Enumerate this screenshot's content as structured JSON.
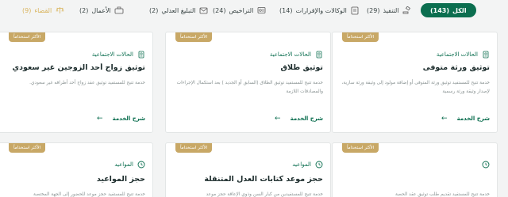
{
  "tabs": [
    {
      "label": "الكل",
      "count": "(143)",
      "icon": "none",
      "active": true
    },
    {
      "label": "التنفيذ",
      "count": "(29)",
      "icon": "gavel-icon"
    },
    {
      "label": "الوكالات والإقرارات",
      "count": "(14)",
      "icon": "document-icon"
    },
    {
      "label": "التراخيص",
      "count": "(24)",
      "icon": "license-icon"
    },
    {
      "label": "التبليغ العدلي",
      "count": "(2)",
      "icon": "mail-icon"
    },
    {
      "label": "الأعمال",
      "count": "(2)",
      "icon": "briefcase-icon"
    },
    {
      "label": "القضاء",
      "count": "(9)",
      "icon": "scales-icon",
      "faded": true
    }
  ],
  "cards_top": [
    {
      "badge": "الأكثر استخداماً",
      "category": "الحالات الاجتماعية",
      "category_icon": "family-icon",
      "title": "توثيق ورثة متوفى",
      "description": "خدمة تتيح للمستفيد توثيق ورثة المتوفى أو إضافة مولود إلى وثيقة ورثة سارية، لإصدار وثيقة ورثة رسمية",
      "more": "شرح الخدمة"
    },
    {
      "badge": "الأكثر استخداماً",
      "category": "الحالات الاجتماعية",
      "category_icon": "family-icon",
      "title": "توثيق طلاق",
      "description": "خدمة تتيح للمستفيد توثيق الطلاق (السابق أو الجديد ) بعد استكمال الإجراءات والمصادقات اللازمة",
      "more": "شرح الخدمة"
    },
    {
      "badge": "الأكثر استخداماً",
      "category": "الحالات الاجتماعية",
      "category_icon": "family-icon",
      "title": "توثيق زواج أحد الزوجين غير سعودي",
      "description": "خدمة تتيح للمستفيد توثيق عقد زواج أحد أطرافه غير سعودي.",
      "more": "شرح الخدمة"
    }
  ],
  "cards_bottom": [
    {
      "badge": "الأكثر استخداماً",
      "category": "",
      "category_icon": "clock-icon",
      "title": "",
      "description": "خدمة تتيح للمستفيد تقديم طلب توثيق عقد الحصة"
    },
    {
      "badge": "الأكثر استخداماً",
      "category": "المواعيد",
      "category_icon": "clock-icon",
      "title": "حجز موعد كتابات العدل المتنقلة",
      "description": "خدمة تتيح للمستفيدين من كبار السن وذوي الإعاقة حجز موعد"
    },
    {
      "badge": "الأكثر استخداماً",
      "category": "المواعيد",
      "category_icon": "clock-icon",
      "title": "حجز المواعيد",
      "description": "خدمة تتيح للمستفيد حجز موعد للحضور إلى الجهة المختصة"
    }
  ]
}
